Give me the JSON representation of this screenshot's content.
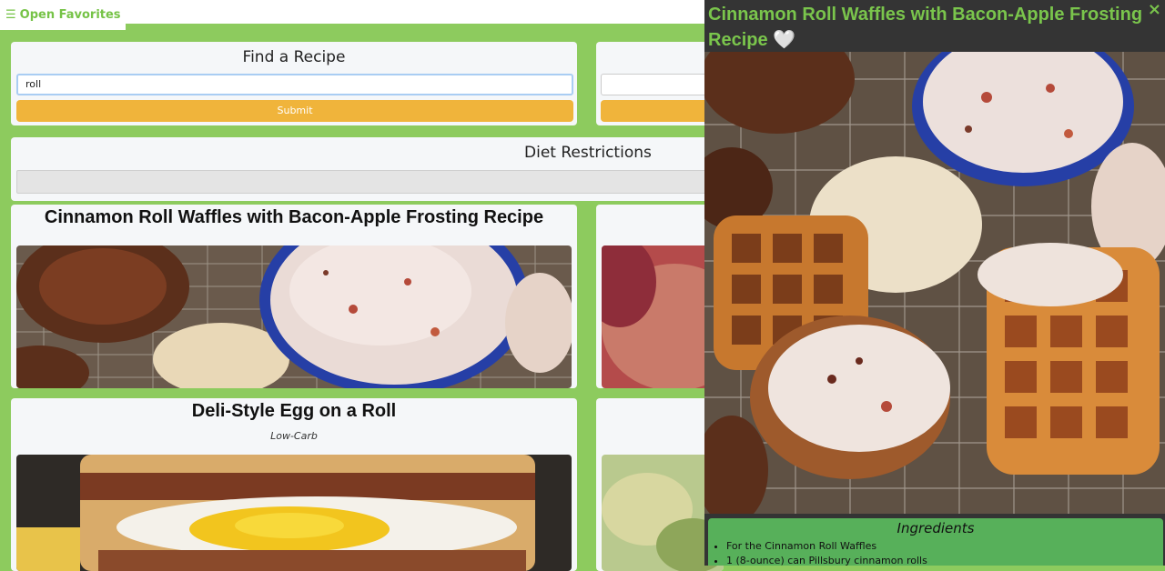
{
  "favorites_button": {
    "icon": "menu-icon",
    "label": "Open Favorites"
  },
  "search": {
    "title": "Find a Recipe",
    "value": "roll",
    "submit_label": "Submit"
  },
  "diet": {
    "title": "Diet Restrictions"
  },
  "results": [
    {
      "title": "Cinnamon Roll Waffles with Bacon-Apple Frosting Recipe",
      "diet": ""
    },
    {
      "title": "Deli-Style Egg on a Roll",
      "diet": "Low-Carb"
    }
  ],
  "panel": {
    "title": "Cinnamon Roll Waffles with Bacon-Apple Frosting Recipe",
    "heart": "🤍",
    "close": "×",
    "ingredients_title": "Ingredients",
    "ingredients": [
      "For the Cinnamon Roll Waffles",
      "1 (8-ounce) can Pillsbury cinnamon rolls"
    ]
  },
  "colors": {
    "background": "#8dcb5e",
    "accent_green": "#76c347",
    "submit": "#f0b43b",
    "panel_bg": "#343434",
    "ingredients_bg": "#57b05a"
  }
}
